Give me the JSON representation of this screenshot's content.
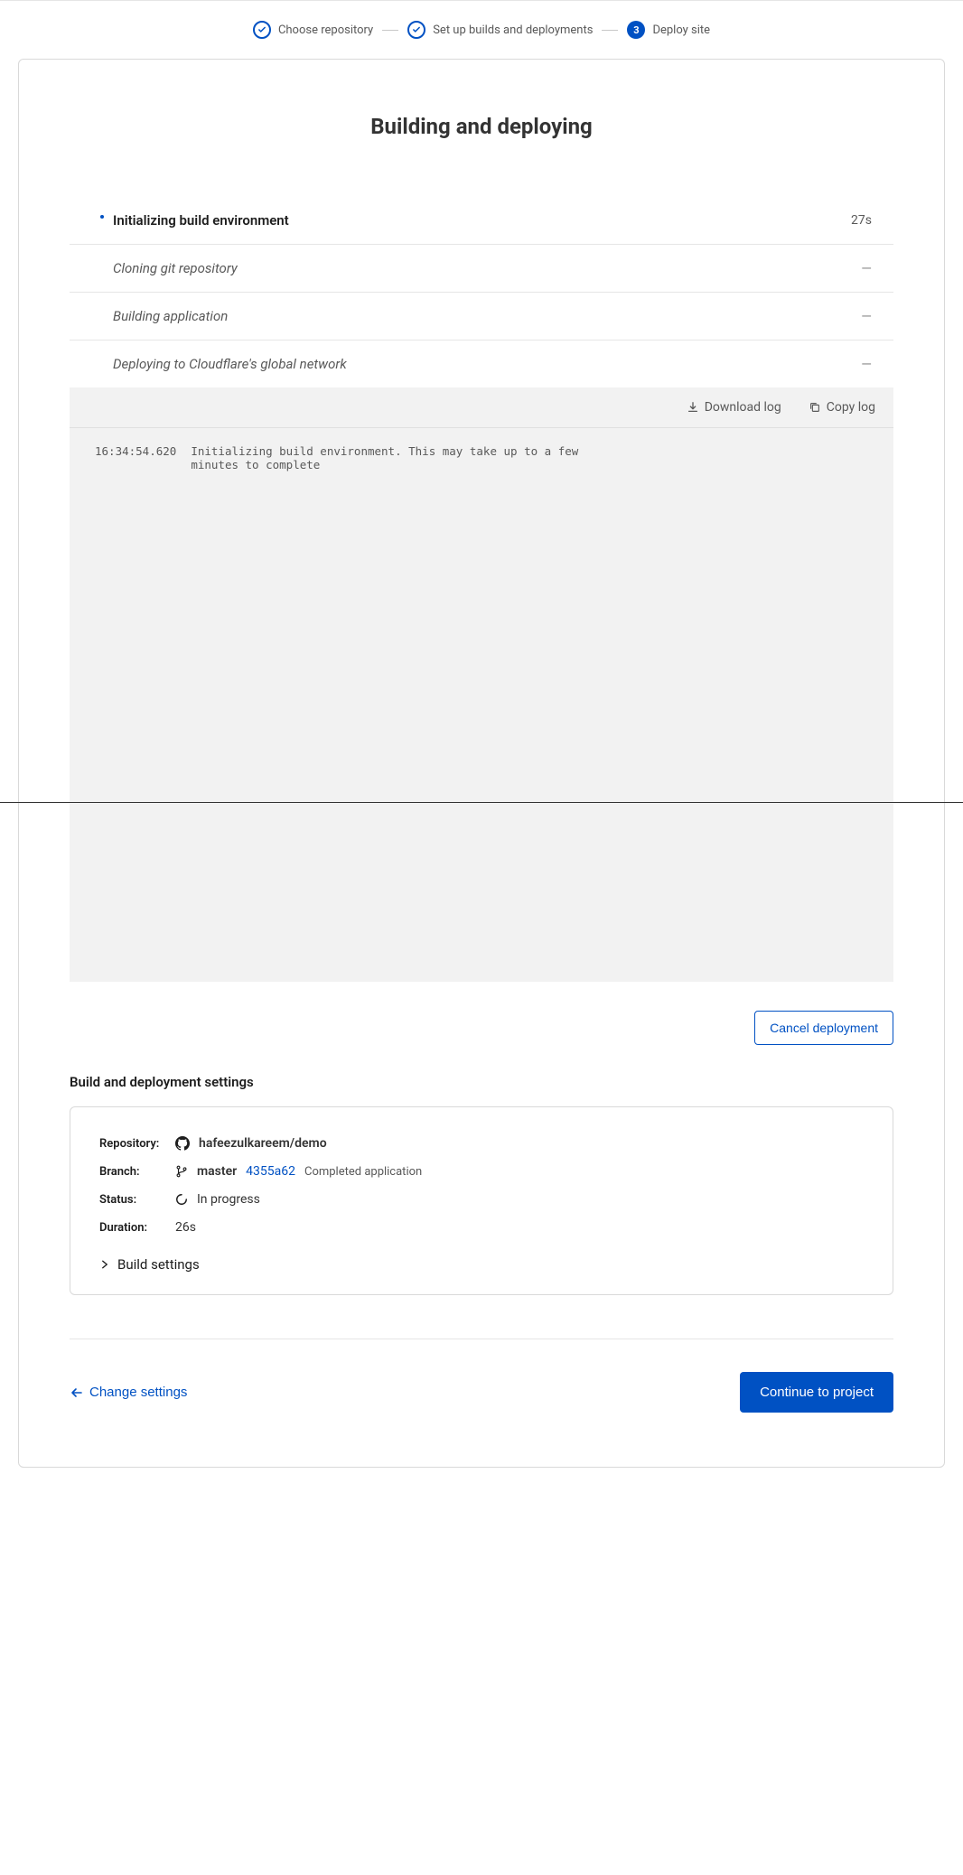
{
  "stepper": {
    "steps": [
      {
        "label": "Choose repository",
        "done": true
      },
      {
        "label": "Set up builds and deployments",
        "done": true
      },
      {
        "label": "Deploy site",
        "num": "3"
      }
    ]
  },
  "title": "Building and deploying",
  "stages": [
    {
      "label": "Initializing build environment",
      "state": "active",
      "time": "27s"
    },
    {
      "label": "Cloning git repository",
      "state": "pending",
      "time": "—"
    },
    {
      "label": "Building application",
      "state": "pending",
      "time": "—"
    },
    {
      "label": "Deploying to Cloudflare's global network",
      "state": "pending",
      "time": "—"
    }
  ],
  "logToolbar": {
    "download": "Download log",
    "copy": "Copy log"
  },
  "log": [
    {
      "ts": "16:34:54.620",
      "msg": "Initializing build environment. This may take up to a few minutes to complete"
    }
  ],
  "cancelLabel": "Cancel deployment",
  "settingsHeading": "Build and deployment settings",
  "settings": {
    "repository": {
      "key": "Repository:",
      "value": "hafeezulkareem/demo"
    },
    "branch": {
      "key": "Branch:",
      "name": "master",
      "commit": "4355a62",
      "msg": "Completed application"
    },
    "status": {
      "key": "Status:",
      "value": "In progress"
    },
    "duration": {
      "key": "Duration:",
      "value": "26s"
    },
    "buildSettingsLabel": "Build settings"
  },
  "footer": {
    "changeSettings": "Change settings",
    "continue": "Continue to project"
  }
}
